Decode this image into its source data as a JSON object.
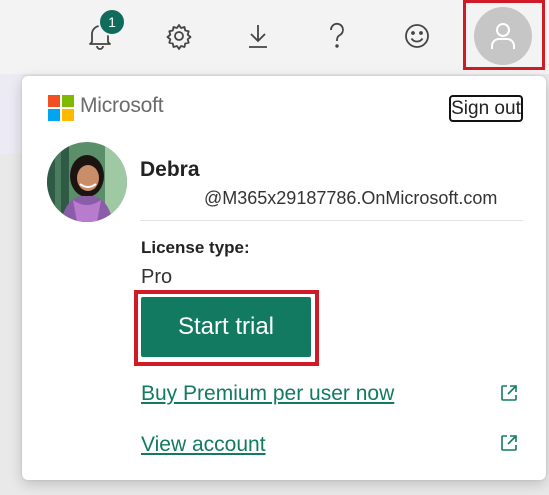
{
  "topbar": {
    "notifications": {
      "icon": "bell-icon",
      "count": "1"
    },
    "settings_icon": "gear-icon",
    "download_icon": "download-icon",
    "help_icon": "question-mark-icon",
    "feedback_icon": "smiley-icon",
    "account_icon": "person-icon"
  },
  "panel": {
    "brand": "Microsoft",
    "sign_out": "Sign out",
    "user": {
      "name": "Debra",
      "email": "@M365x29187786.OnMicrosoft.com"
    },
    "license": {
      "label": "License type:",
      "value": "Pro"
    },
    "start_trial": "Start trial",
    "links": [
      {
        "label": "Buy Premium per user now",
        "icon": "external-link-icon"
      },
      {
        "label": "View account",
        "icon": "external-link-icon"
      }
    ]
  },
  "colors": {
    "accent": "#127a60",
    "badge": "#0f6b5c",
    "highlight": "#d01a26",
    "ms_red": "#f25022",
    "ms_green": "#7fba00",
    "ms_blue": "#00a4ef",
    "ms_yellow": "#ffb900"
  }
}
